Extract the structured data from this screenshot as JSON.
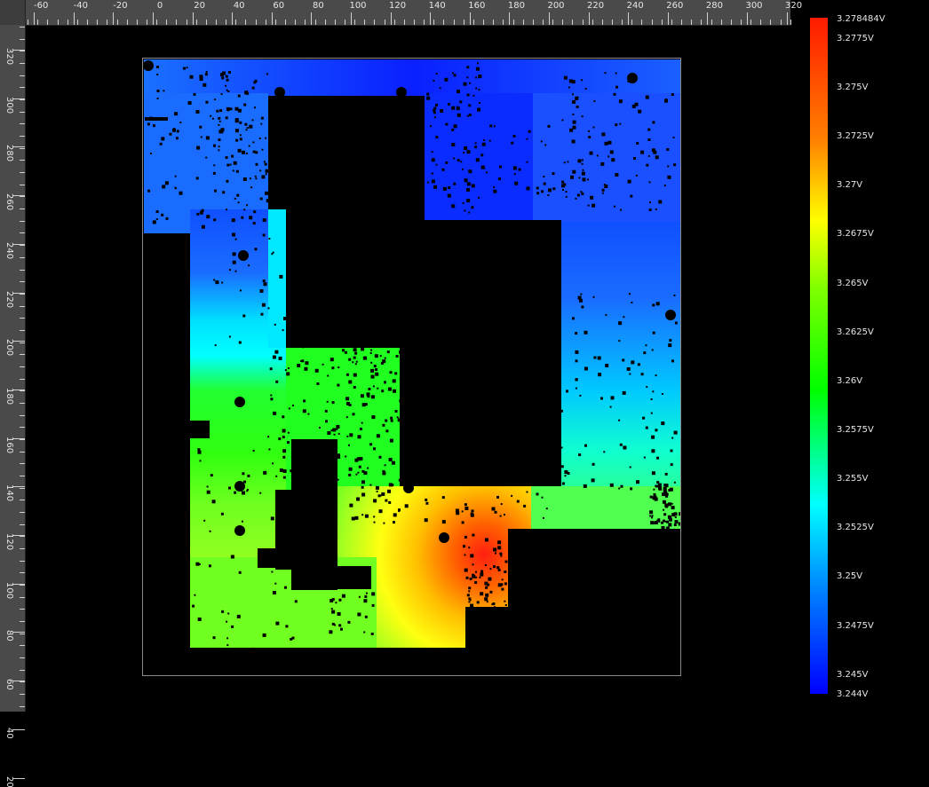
{
  "ruler_x": {
    "labels": [
      "-60",
      "-40",
      "-20",
      "0",
      "20",
      "40",
      "60",
      "80",
      "100",
      "120",
      "140",
      "160",
      "180",
      "200",
      "220",
      "240",
      "260",
      "280",
      "300",
      "320"
    ]
  },
  "ruler_y": {
    "labels": [
      "320",
      "300",
      "280",
      "260",
      "240",
      "220",
      "200",
      "180",
      "160",
      "140",
      "120",
      "100",
      "80",
      "60",
      "40",
      "20"
    ]
  },
  "legend": {
    "labels": [
      "3.278484V",
      "3.2775V",
      "3.275V",
      "3.2725V",
      "3.27V",
      "3.2675V",
      "3.265V",
      "3.2625V",
      "3.26V",
      "3.2575V",
      "3.255V",
      "3.2525V",
      "3.25V",
      "3.2475V",
      "3.245V",
      "3.244V"
    ],
    "colors": [
      "#ff1a00",
      "#ff8000",
      "#ffff00",
      "#80ff00",
      "#00ff00",
      "#00ffff",
      "#0080ff",
      "#0000ff"
    ]
  },
  "heatmap": {
    "regions": [
      {
        "name": "top-left-blue",
        "color": "#1a6cff"
      },
      {
        "name": "top-center-blue",
        "color": "#0a2cff"
      },
      {
        "name": "top-right-blue",
        "color": "#1a5aff"
      },
      {
        "name": "left-cyan",
        "color": "#00ffff"
      },
      {
        "name": "right-cyan",
        "color": "#20e8ff"
      },
      {
        "name": "left-green",
        "color": "#20ff20"
      },
      {
        "name": "right-green",
        "color": "#30ff70"
      },
      {
        "name": "bottom-left-green",
        "color": "#60ff20"
      },
      {
        "name": "bottom-yellow",
        "color": "#ffff20"
      },
      {
        "name": "hotspot-red",
        "color": "#ff3010"
      }
    ]
  }
}
